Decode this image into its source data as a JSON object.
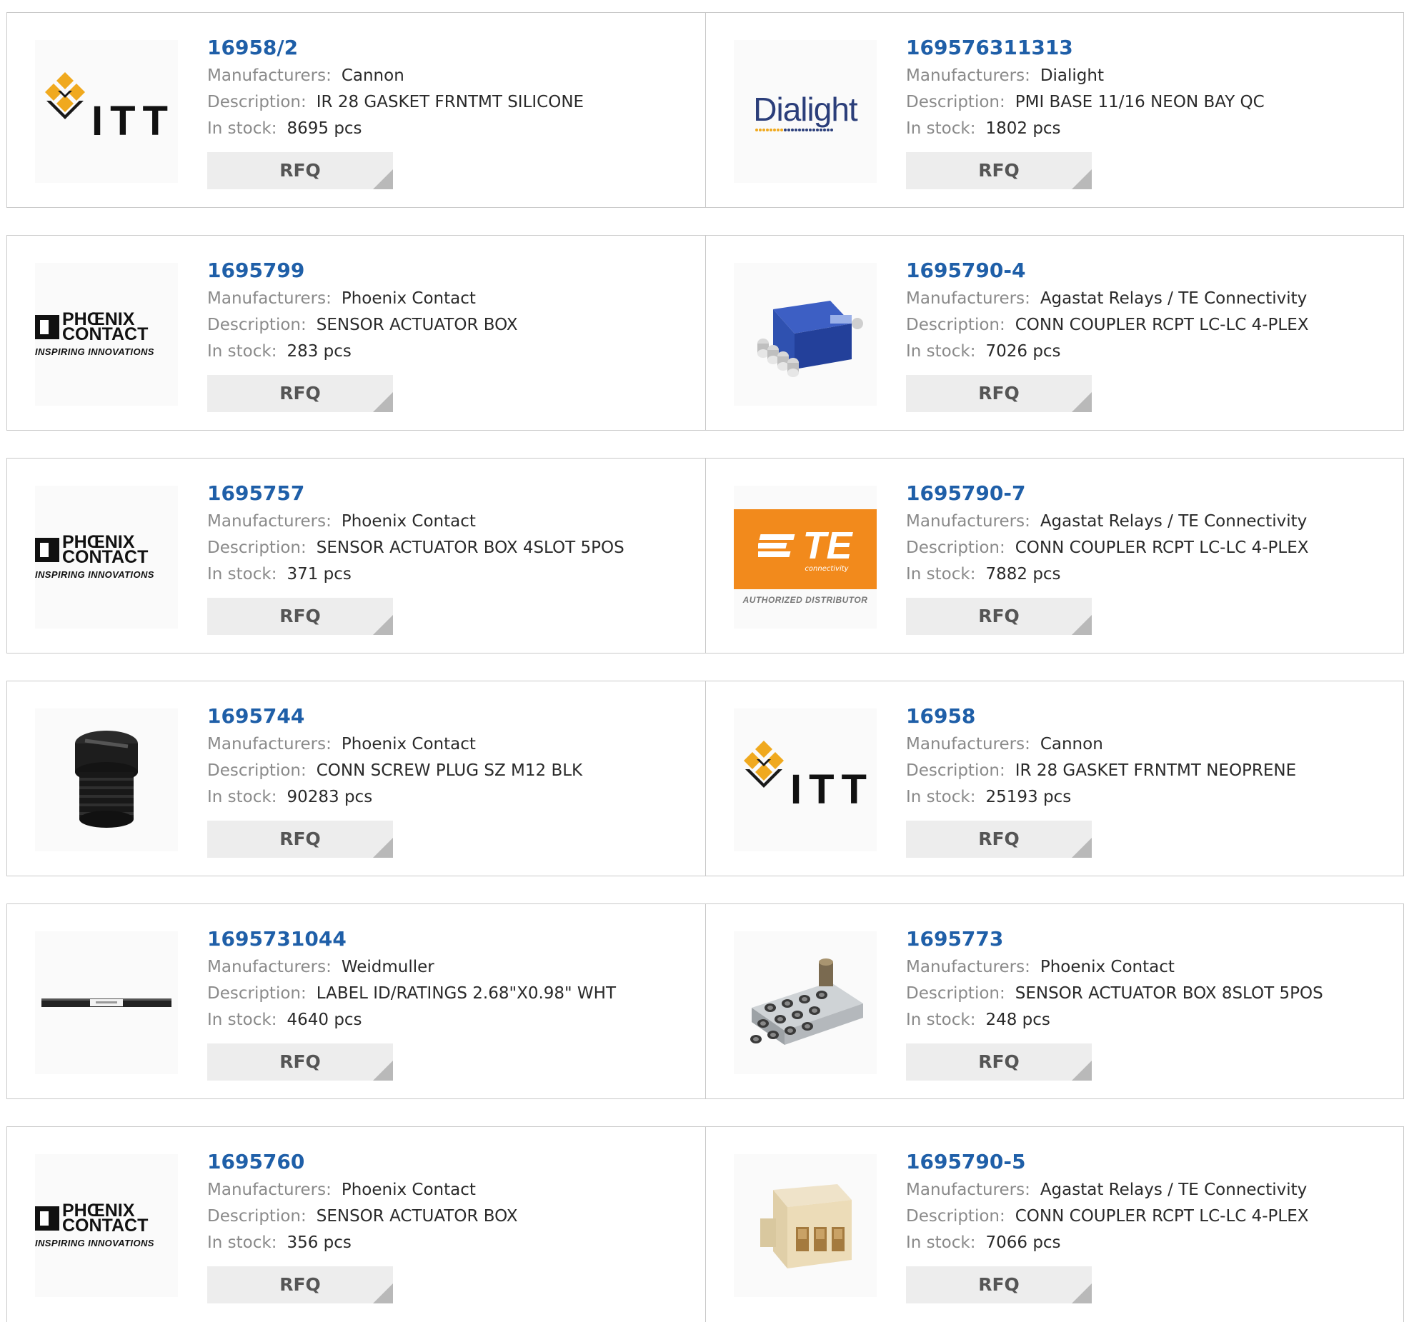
{
  "button_label": "RFQ",
  "labels": {
    "manufacturers": "Manufacturers:",
    "description": "Description:",
    "in_stock": "In stock:"
  },
  "colors": {
    "part_link": "#1f5fa8",
    "border": "#c9c9c9",
    "button_bg": "#ededed",
    "te_orange": "#f28a1c",
    "dialight_blue": "#2b3e7a"
  },
  "products": [
    {
      "part": "16958/2",
      "manufacturer": "Cannon",
      "description": "IR 28 GASKET FRNTMT SILICONE",
      "stock": "8695 pcs",
      "image": "itt-logo"
    },
    {
      "part": "169576311313",
      "manufacturer": "Dialight",
      "description": "PMI BASE 11/16 NEON BAY QC",
      "stock": "1802 pcs",
      "image": "dialight-logo",
      "image_text": "Dialight"
    },
    {
      "part": "1695799",
      "manufacturer": "Phoenix Contact",
      "description": "SENSOR ACTUATOR BOX",
      "stock": "283 pcs",
      "image": "phoenix-contact-logo",
      "image_text": "PHŒNIX CONTACT",
      "image_subtext": "INSPIRING INNOVATIONS"
    },
    {
      "part": "1695790-4",
      "manufacturer": "Agastat Relays / TE Connectivity",
      "description": "CONN COUPLER RCPT LC-LC 4-PLEX",
      "stock": "7026 pcs",
      "image": "blue-lc-coupler-photo"
    },
    {
      "part": "1695757",
      "manufacturer": "Phoenix Contact",
      "description": "SENSOR ACTUATOR BOX 4SLOT 5POS",
      "stock": "371 pcs",
      "image": "phoenix-contact-logo",
      "image_text": "PHŒNIX CONTACT",
      "image_subtext": "INSPIRING INNOVATIONS"
    },
    {
      "part": "1695790-7",
      "manufacturer": "Agastat Relays / TE Connectivity",
      "description": "CONN COUPLER RCPT LC-LC 4-PLEX",
      "stock": "7882 pcs",
      "image": "te-connectivity-logo",
      "image_text": "TE",
      "image_small": "connectivity",
      "image_subtext": "AUTHORIZED DISTRIBUTOR"
    },
    {
      "part": "1695744",
      "manufacturer": "Phoenix Contact",
      "description": "CONN SCREW PLUG SZ M12 BLK",
      "stock": "90283 pcs",
      "image": "black-screw-plug-photo"
    },
    {
      "part": "16958",
      "manufacturer": "Cannon",
      "description": "IR 28 GASKET FRNTMT NEOPRENE",
      "stock": "25193 pcs",
      "image": "itt-logo"
    },
    {
      "part": "1695731044",
      "manufacturer": "Weidmuller",
      "description": "LABEL ID/RATINGS 2.68\"X0.98\" WHT",
      "stock": "4640 pcs",
      "image": "label-strip-photo"
    },
    {
      "part": "1695773",
      "manufacturer": "Phoenix Contact",
      "description": "SENSOR ACTUATOR BOX 8SLOT 5POS",
      "stock": "248 pcs",
      "image": "sensor-box-photo"
    },
    {
      "part": "1695760",
      "manufacturer": "Phoenix Contact",
      "description": "SENSOR ACTUATOR BOX",
      "stock": "356 pcs",
      "image": "phoenix-contact-logo",
      "image_text": "PHŒNIX CONTACT",
      "image_subtext": "INSPIRING INNOVATIONS"
    },
    {
      "part": "1695790-5",
      "manufacturer": "Agastat Relays / TE Connectivity",
      "description": "CONN COUPLER RCPT LC-LC 4-PLEX",
      "stock": "7066 pcs",
      "image": "beige-lc-coupler-photo"
    }
  ]
}
